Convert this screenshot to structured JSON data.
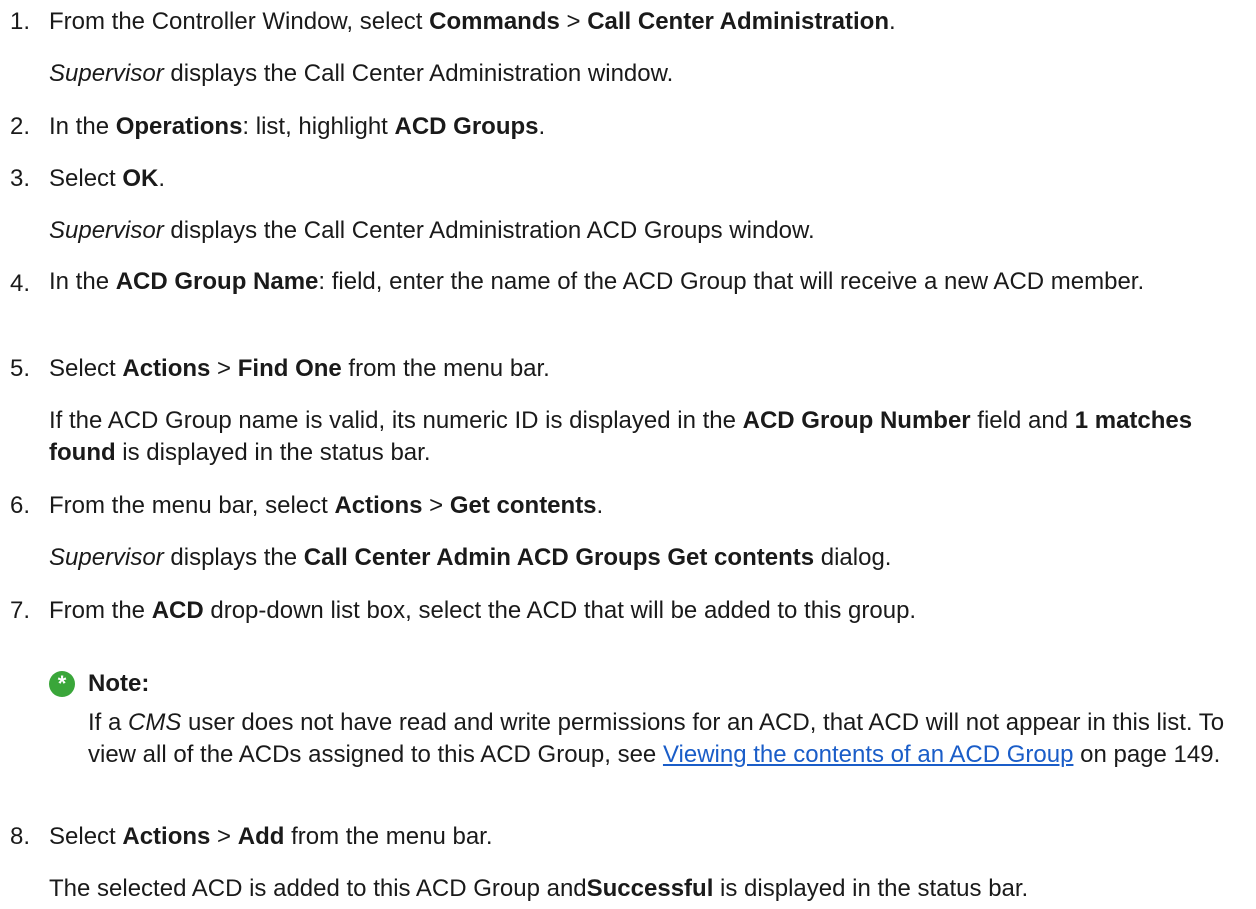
{
  "steps": [
    {
      "num": "1.",
      "parts": [
        {
          "t": "From the Controller Window, select "
        },
        {
          "t": "Commands",
          "b": true
        },
        {
          "t": " > "
        },
        {
          "t": "Call Center Administration",
          "b": true
        },
        {
          "t": "."
        }
      ],
      "result": [
        {
          "t": "Supervisor",
          "i": true
        },
        {
          "t": " displays the Call Center Administration window."
        }
      ]
    },
    {
      "num": "2.",
      "parts": [
        {
          "t": "In the "
        },
        {
          "t": "Operations",
          "b": true
        },
        {
          "t": ": list, highlight "
        },
        {
          "t": "ACD Groups",
          "b": true
        },
        {
          "t": "."
        }
      ]
    },
    {
      "num": "3.",
      "parts": [
        {
          "t": "Select "
        },
        {
          "t": "OK",
          "b": true
        },
        {
          "t": "."
        }
      ],
      "result": [
        {
          "t": "Supervisor",
          "i": true
        },
        {
          "t": " displays the Call Center Administration ACD Groups window."
        }
      ]
    },
    {
      "num": "4.",
      "parts": [
        {
          "t": "In the "
        },
        {
          "t": "ACD Group Name",
          "b": true
        },
        {
          "t": ": field, enter the name of the ACD Group that will receive a new ACD member."
        }
      ]
    },
    {
      "num": "5.",
      "parts": [
        {
          "t": "Select "
        },
        {
          "t": "Actions",
          "b": true
        },
        {
          "t": " > "
        },
        {
          "t": "Find One",
          "b": true
        },
        {
          "t": " from the menu bar."
        }
      ],
      "result": [
        {
          "t": "If the ACD Group name is valid, its numeric ID is displayed in the "
        },
        {
          "t": "ACD Group Number",
          "b": true
        },
        {
          "t": " field and "
        },
        {
          "t": "1 matches found",
          "b": true
        },
        {
          "t": " is displayed in the status bar."
        }
      ]
    },
    {
      "num": "6.",
      "parts": [
        {
          "t": "From the menu bar, select "
        },
        {
          "t": "Actions",
          "b": true
        },
        {
          "t": " > "
        },
        {
          "t": "Get contents",
          "b": true
        },
        {
          "t": "."
        }
      ],
      "result": [
        {
          "t": "Supervisor",
          "i": true
        },
        {
          "t": " displays the "
        },
        {
          "t": "Call Center Admin ACD Groups Get contents",
          "b": true
        },
        {
          "t": " dialog."
        }
      ]
    },
    {
      "num": "7.",
      "parts": [
        {
          "t": "From the "
        },
        {
          "t": "ACD",
          "b": true
        },
        {
          "t": " drop-down list box, select the ACD that will be added to this group."
        }
      ]
    },
    {
      "num": "8.",
      "parts": [
        {
          "t": "Select "
        },
        {
          "t": "Actions",
          "b": true
        },
        {
          "t": " > "
        },
        {
          "t": "Add",
          "b": true
        },
        {
          "t": " from the menu bar."
        }
      ],
      "result": [
        {
          "t": "The selected ACD is added to this ACD Group and"
        },
        {
          "t": "Successful",
          "b": true
        },
        {
          "t": " is displayed in the status bar."
        }
      ]
    }
  ],
  "note": {
    "icon_glyph": "*",
    "icon_color": "#3aa63a",
    "label": "Note:",
    "parts": [
      {
        "t": "If a "
      },
      {
        "t": "CMS",
        "i": true
      },
      {
        "t": " user does not have read and write permissions for an ACD, that ACD will not appear in this list. To view all of the ACDs assigned to this ACD Group, see "
      },
      {
        "t": "Viewing the contents of an ACD Group",
        "link": true
      },
      {
        "t": " on page 149."
      }
    ]
  },
  "link_color": "#1a5dc8"
}
